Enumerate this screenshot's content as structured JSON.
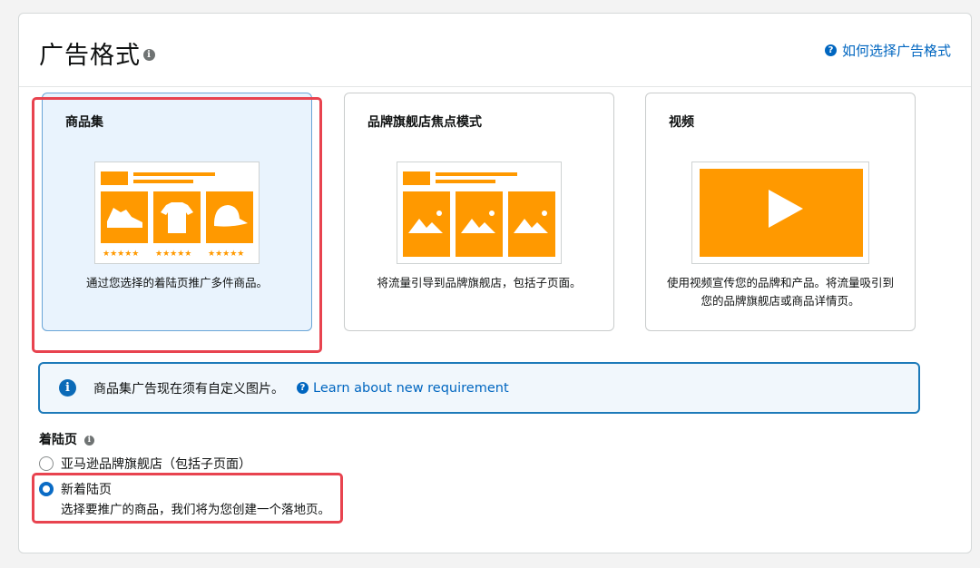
{
  "header": {
    "title": "广告格式",
    "help_link": "如何选择广告格式"
  },
  "cards": [
    {
      "title": "商品集",
      "description": "通过您选择的着陆页推广多件商品。",
      "selected": true
    },
    {
      "title": "品牌旗舰店焦点模式",
      "description": "将流量引导到品牌旗舰店，包括子页面。",
      "selected": false
    },
    {
      "title": "视频",
      "description": "使用视频宣传您的品牌和产品。将流量吸引到您的品牌旗舰店或商品详情页。",
      "selected": false
    }
  ],
  "notice": {
    "text": "商品集广告现在须有自定义图片。",
    "link": "Learn about new requirement"
  },
  "landing_page": {
    "title": "着陆页",
    "options": [
      {
        "label": "亚马逊品牌旗舰店（包括子页面）",
        "selected": false
      },
      {
        "label": "新着陆页",
        "selected": true,
        "sublabel": "选择要推广的商品，我们将为您创建一个落地页。"
      }
    ]
  },
  "colors": {
    "accent_orange": "#ff9900",
    "link_blue": "#0066c0",
    "highlight_red": "#e8434f"
  }
}
